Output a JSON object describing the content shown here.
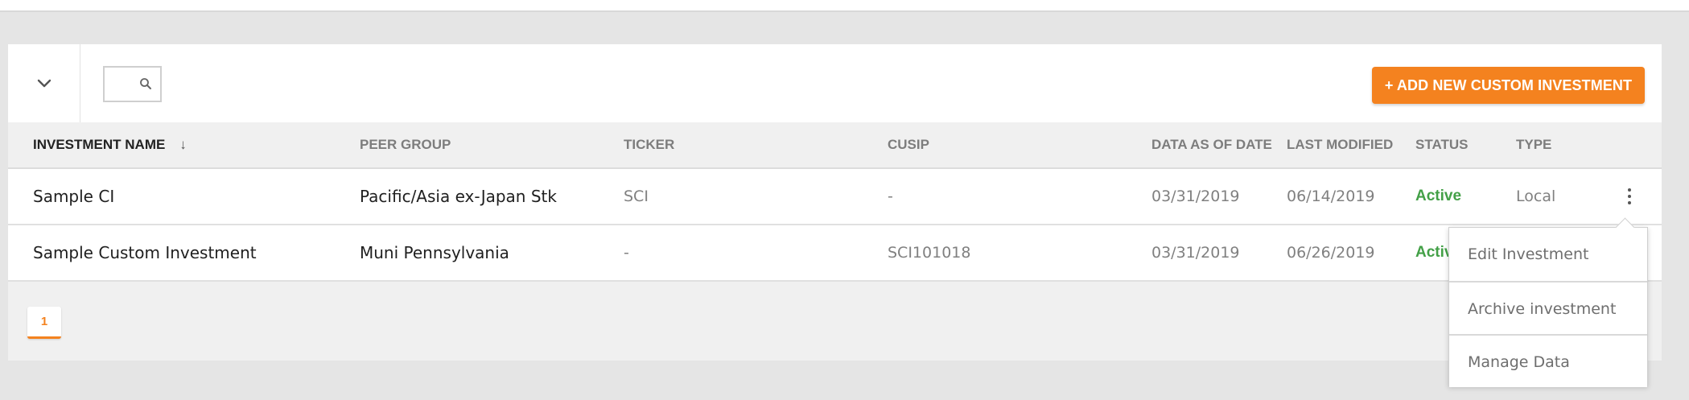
{
  "colors": {
    "accent": "#f4821f",
    "status_active": "#43a047",
    "panel_bg": "#f0f0f0",
    "page_bg": "#e5e5e5"
  },
  "toolbar": {
    "collapse_icon": "chevron-down-icon",
    "search": {
      "value": "",
      "placeholder": "",
      "icon": "search-icon"
    },
    "add_button_label": "+ ADD NEW CUSTOM INVESTMENT"
  },
  "table": {
    "columns": {
      "name": "INVESTMENT NAME",
      "peer_group": "PEER GROUP",
      "ticker": "TICKER",
      "cusip": "CUSIP",
      "data_as_of": "DATA AS OF DATE",
      "last_modified": "LAST MODIFIED",
      "status": "STATUS",
      "type": "TYPE"
    },
    "sort": {
      "column": "name",
      "arrow": "↓"
    },
    "rows": [
      {
        "name": "Sample CI",
        "peer_group": "Pacific/Asia ex-Japan Stk",
        "ticker": "SCI",
        "cusip": "-",
        "data_as_of": "03/31/2019",
        "last_modified": "06/14/2019",
        "status": "Active",
        "type": "Local"
      },
      {
        "name": "Sample Custom Investment",
        "peer_group": "Muni Pennsylvania",
        "ticker": "-",
        "cusip": "SCI101018",
        "data_as_of": "03/31/2019",
        "last_modified": "06/26/2019",
        "status": "Active",
        "type": ""
      }
    ]
  },
  "pagination": {
    "current_page": "1"
  },
  "row_menu": {
    "items": [
      "Edit Investment",
      "Archive investment",
      "Manage Data"
    ]
  }
}
